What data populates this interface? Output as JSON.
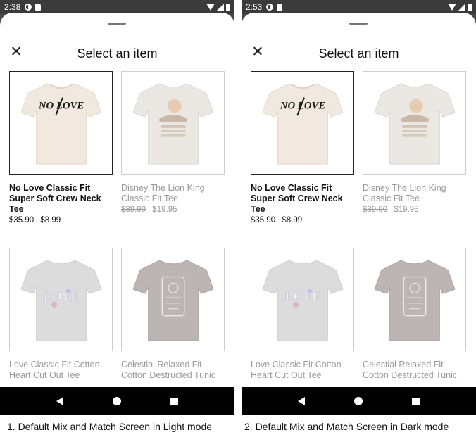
{
  "screens": [
    {
      "status": {
        "time": "2:38"
      },
      "sheet": {
        "title": "Select an item"
      },
      "items": [
        {
          "name": "No Love Classic Fit Super Soft Crew Neck Tee",
          "old_price": "$35.90",
          "price": "$8.99"
        },
        {
          "name": "Disney The Lion King Classic Fit Tee",
          "old_price": "$39.90",
          "price": "$19.95"
        },
        {
          "name": "Love Classic Fit Cotton Heart Cut Out Tee"
        },
        {
          "name": "Celestial Relaxed Fit Cotton Destructed Tunic"
        }
      ],
      "caption": "1. Default Mix and Match Screen in Light mode"
    },
    {
      "status": {
        "time": "2:53"
      },
      "sheet": {
        "title": "Select an item"
      },
      "items": [
        {
          "name": "No Love Classic Fit Super Soft Crew Neck Tee",
          "old_price": "$35.90",
          "price": "$8.99"
        },
        {
          "name": "Disney The Lion King Classic Fit Tee",
          "old_price": "$39.90",
          "price": "$19.95"
        },
        {
          "name": "Love Classic Fit Cotton Heart Cut Out Tee"
        },
        {
          "name": "Celestial Relaxed Fit Cotton Destructed Tunic"
        }
      ],
      "caption": "2. Default Mix and Match Screen in Dark mode"
    }
  ],
  "icons": {
    "status": [
      "data-saver-icon",
      "sd-card-icon",
      "wifi-icon",
      "signal-icon",
      "battery-icon"
    ],
    "nav": [
      "back-icon",
      "home-icon",
      "recents-icon"
    ],
    "sheet": [
      "close-icon",
      "drag-handle"
    ]
  },
  "colors": {
    "selected_border": "#222222",
    "muted_text": "#9a9a9a",
    "nav_bar": "#000000",
    "status_bar": "#3b3b3b"
  },
  "product_images": {
    "no_love_tee_text": "NO LOVE",
    "love_tee_text": "LOVE"
  }
}
